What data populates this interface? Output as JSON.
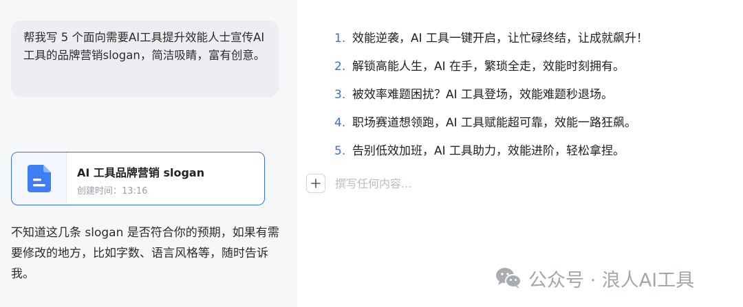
{
  "user_message": {
    "text": "帮我写 5 个面向需要AI工具提升效能人士宣传AI工具的品牌营销slogan，简洁吸睛，富有创意。"
  },
  "doc_card": {
    "icon": "document-icon",
    "title": "AI 工具品牌营销 slogan",
    "created_label": "创建时间：13:16"
  },
  "assistant_reply": {
    "text": "不知道这几条 slogan 是否符合你的预期，如果有需要修改的地方，比如字数、语言风格等，随时告诉我。"
  },
  "document": {
    "items": [
      {
        "num": "1.",
        "text": "效能逆袭，AI 工具一键开启，让忙碌终结，让成就飙升！"
      },
      {
        "num": "2.",
        "text": "解锁高能人生，AI 在手，繁琐全走，效能时刻拥有。"
      },
      {
        "num": "3.",
        "text": "被效率难题困扰？AI 工具登场，效能难题秒退场。"
      },
      {
        "num": "4.",
        "text": "职场赛道想领跑，AI 工具赋能超可靠，效能一路狂飙。"
      },
      {
        "num": "5.",
        "text": "告别低效加班，AI 工具助力，效能进阶，轻松拿捏。"
      }
    ],
    "compose_placeholder": "撰写任何内容..."
  },
  "watermark": {
    "icon": "wechat-icon",
    "text": "公众号 · 浪人AI工具"
  },
  "colors": {
    "accent": "#2f6df6",
    "list_number": "#3b6fd8",
    "left_background": "#f6f7f9",
    "bubble": "#eceef2"
  }
}
